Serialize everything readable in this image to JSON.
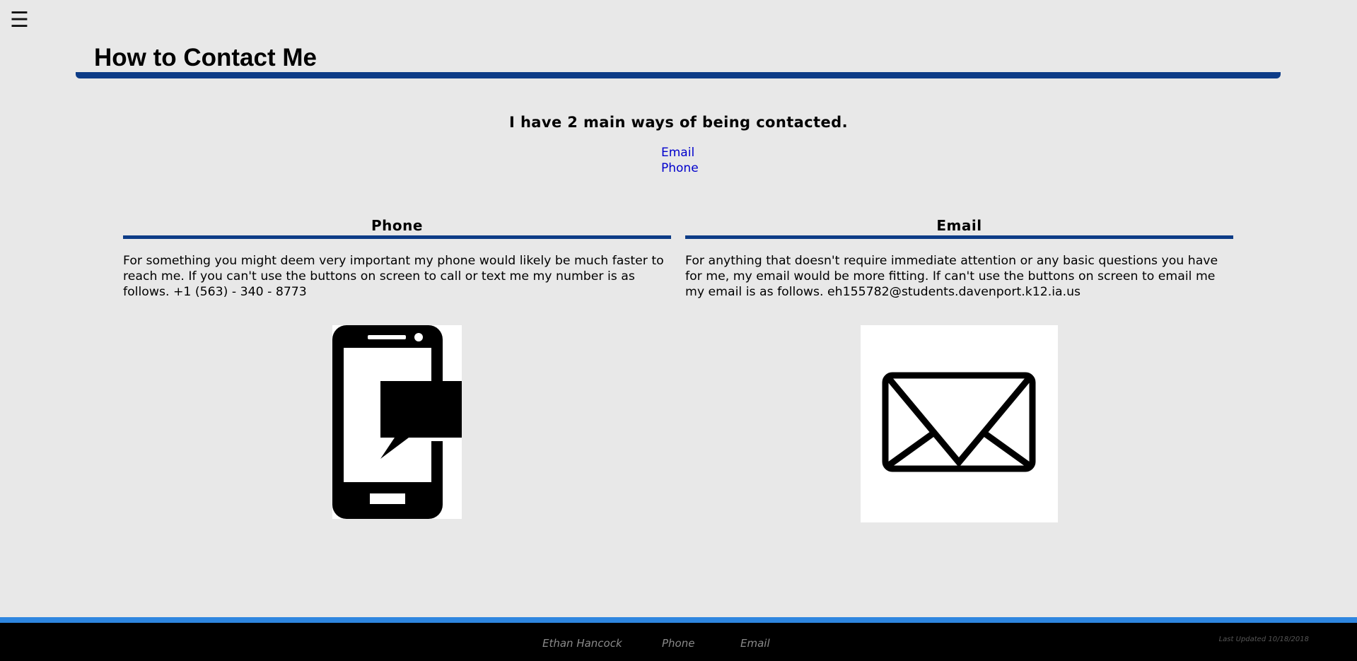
{
  "menu": {
    "icon": "hamburger-menu-icon",
    "glyph": "☰"
  },
  "header": {
    "title": "How to Contact Me"
  },
  "intro": {
    "heading": "I have 2 main ways of being contacted.",
    "links": [
      "Email",
      "Phone"
    ]
  },
  "sections": {
    "phone": {
      "heading": "Phone",
      "body": "For something you might deem very important my phone would likely be much faster to reach me. If you can't use the buttons on screen to call or text me my number is as follows. +1 (563) - 340 - 8773",
      "icon": "phone-message-icon"
    },
    "email": {
      "heading": "Email",
      "body": "For anything that doesn't require immediate attention or any basic questions you have for me, my email would be more fitting. If can't use the buttons on screen to email me my email is as follows. eh155782@students.davenport.k12.ia.us",
      "icon": "envelope-icon"
    }
  },
  "footer": {
    "name": "Ethan Hancock",
    "phone_link": "Phone",
    "email_link": "Email",
    "last_updated": "Last Updated 10/18/2018"
  },
  "colors": {
    "background": "#e8e8e8",
    "accent_rule": "#0d3c87",
    "footer_stripe": "#2e86e0",
    "footer_bg": "#000000",
    "link": "#0000cc"
  }
}
